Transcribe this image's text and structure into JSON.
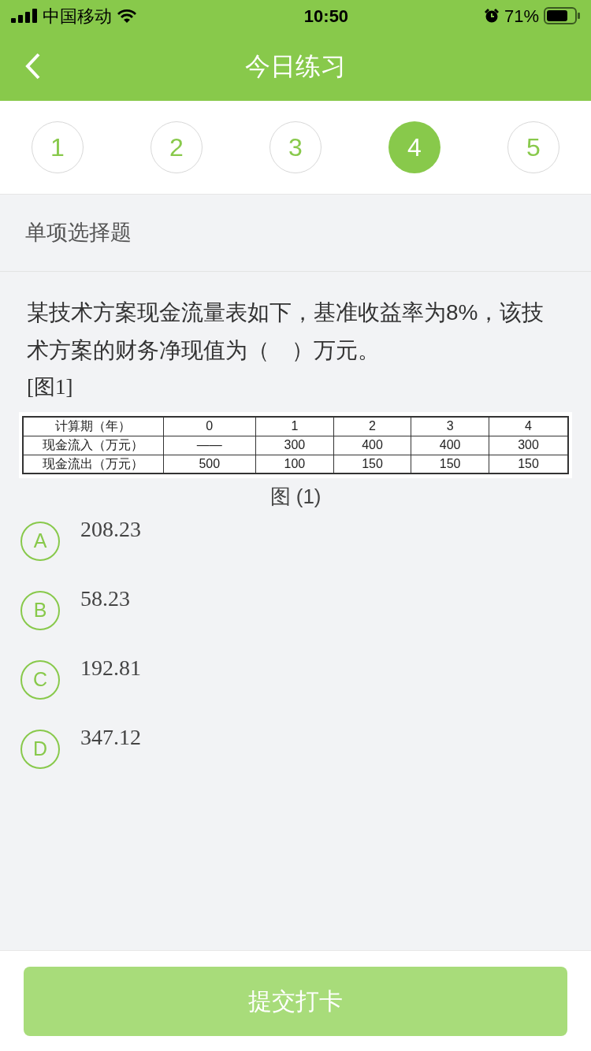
{
  "status_bar": {
    "carrier": "中国移动",
    "time": "10:50",
    "battery": "71%"
  },
  "header": {
    "title": "今日练习"
  },
  "steps": [
    {
      "label": "1",
      "selected": false
    },
    {
      "label": "2",
      "selected": false
    },
    {
      "label": "3",
      "selected": false
    },
    {
      "label": "4",
      "selected": true
    },
    {
      "label": "5",
      "selected": false
    }
  ],
  "section": "单项选择题",
  "question": {
    "text": "某技术方案现金流量表如下，基准收益率为8%，该技术方案的财务净现值为（　）万元。",
    "figure_ref": "[图1]",
    "table": {
      "rows": [
        [
          "计算期（年）",
          "0",
          "1",
          "2",
          "3",
          "4"
        ],
        [
          "现金流入（万元）",
          "——",
          "300",
          "400",
          "400",
          "300"
        ],
        [
          "现金流出（万元）",
          "500",
          "100",
          "150",
          "150",
          "150"
        ]
      ]
    },
    "caption": "图 (1)"
  },
  "options": [
    {
      "letter": "A",
      "text": "208.23",
      "selected": false
    },
    {
      "letter": "B",
      "text": "58.23",
      "selected": false
    },
    {
      "letter": "C",
      "text": "192.81",
      "selected": false
    },
    {
      "letter": "D",
      "text": "347.12",
      "selected": false
    }
  ],
  "submit": {
    "label": "提交打卡",
    "disabled": true
  }
}
